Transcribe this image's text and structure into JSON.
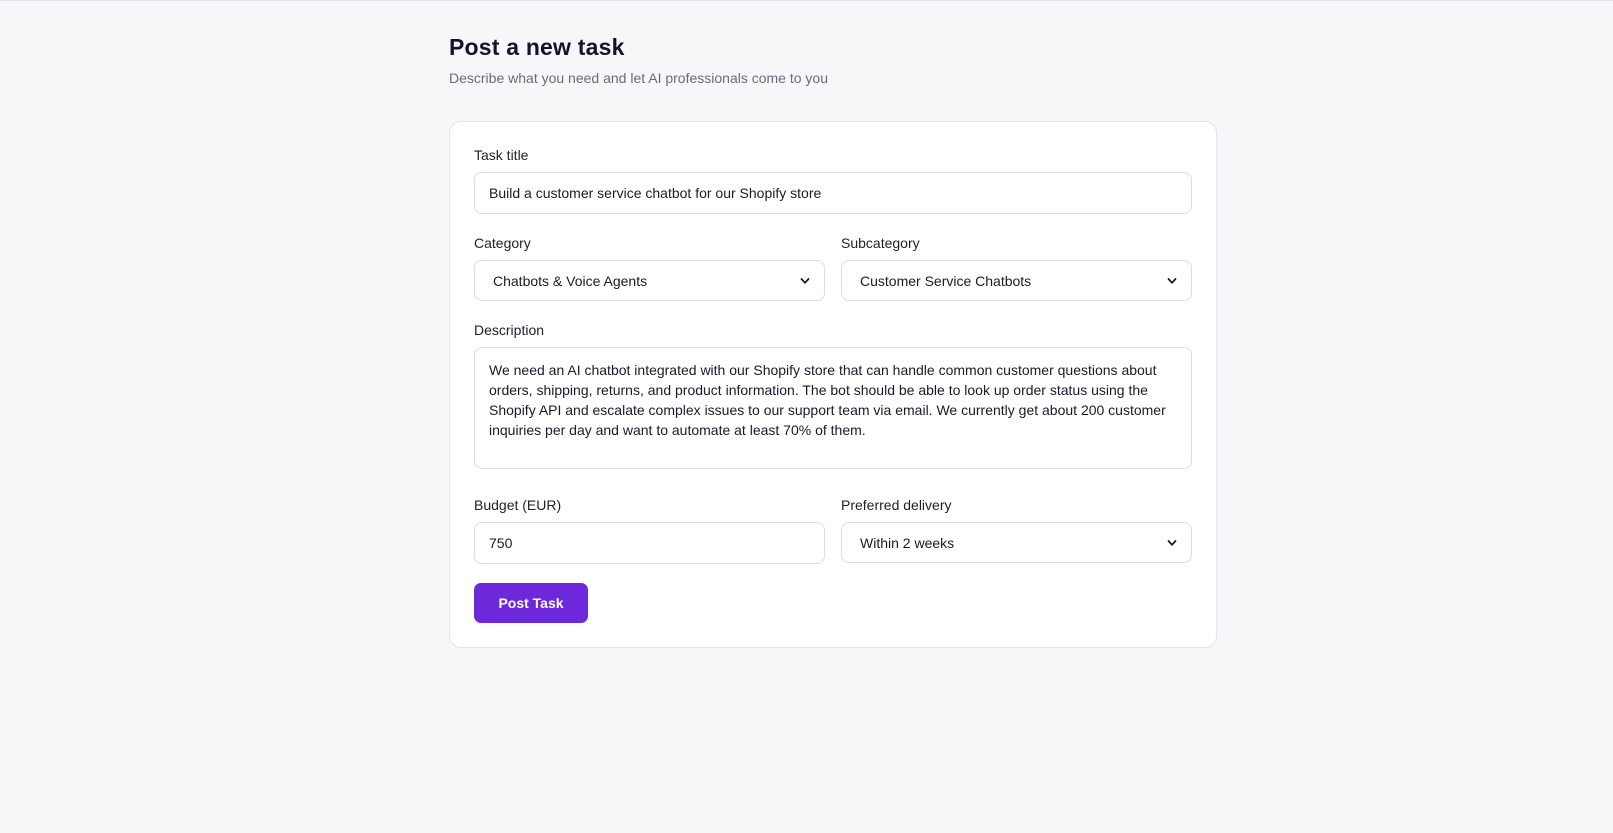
{
  "header": {
    "title": "Post a new task",
    "subtitle": "Describe what you need and let AI professionals come to you"
  },
  "form": {
    "task_title": {
      "label": "Task title",
      "value": "Build a customer service chatbot for our Shopify store"
    },
    "category": {
      "label": "Category",
      "selected": "Chatbots & Voice Agents"
    },
    "subcategory": {
      "label": "Subcategory",
      "selected": "Customer Service Chatbots"
    },
    "description": {
      "label": "Description",
      "value": "We need an AI chatbot integrated with our Shopify store that can handle common customer questions about orders, shipping, returns, and product information. The bot should be able to look up order status using the Shopify API and escalate complex issues to our support team via email. We currently get about 200 customer inquiries per day and want to automate at least 70% of them."
    },
    "budget": {
      "label": "Budget (EUR)",
      "value": "750"
    },
    "delivery": {
      "label": "Preferred delivery",
      "selected": "Within 2 weeks"
    },
    "submit_label": "Post Task"
  },
  "icons": {
    "select_arrow": "chevron-down-icon"
  },
  "colors": {
    "accent": "#6d28d9",
    "background": "#f7f7fa",
    "card": "#ffffff"
  }
}
